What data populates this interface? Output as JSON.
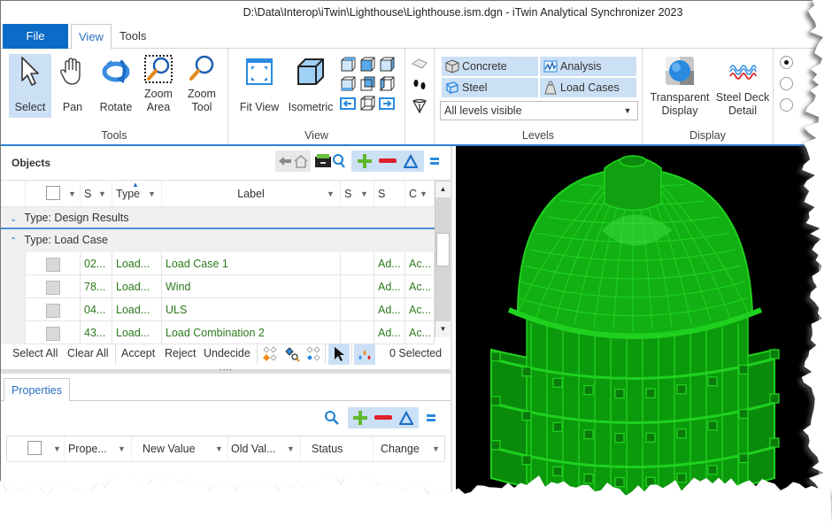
{
  "window": {
    "title": "D:\\Data\\Interop\\iTwin\\Lighthouse\\Lighthouse.ism.dgn - iTwin Analytical Synchronizer 2023"
  },
  "ribbon_tabs": [
    {
      "label": "File",
      "state": "file"
    },
    {
      "label": "View",
      "state": "active"
    },
    {
      "label": "Tools",
      "state": "normal"
    }
  ],
  "ribbon": {
    "tools_group": {
      "label": "Tools",
      "buttons": [
        {
          "label": "Select",
          "icon": "cursor-arrow-icon",
          "selected": true
        },
        {
          "label": "Pan",
          "icon": "hand-icon"
        },
        {
          "label": "Rotate",
          "icon": "rotate-icon"
        },
        {
          "label": "Zoom Area",
          "icon": "zoom-area-icon"
        },
        {
          "label": "Zoom Tool",
          "icon": "zoom-tool-icon"
        }
      ]
    },
    "view_group": {
      "label": "View",
      "buttons": [
        {
          "label": "Fit View",
          "icon": "fit-view-icon"
        },
        {
          "label": "Isometric",
          "icon": "isometric-cube-icon"
        }
      ],
      "view_cubes": [
        "top-view",
        "front-view",
        "right-view",
        "bottom-view",
        "back-view",
        "left-view",
        "rotate-left",
        "iso-view",
        "rotate-right"
      ]
    },
    "nav_group": {
      "buttons": [
        "fly-icon",
        "walk-footprints-icon",
        "clip-volume-icon"
      ]
    },
    "levels_group": {
      "label": "Levels",
      "toggles": [
        {
          "label": "Concrete",
          "icon": "concrete-cube-icon"
        },
        {
          "label": "Analysis",
          "icon": "analysis-chart-icon"
        },
        {
          "label": "Steel",
          "icon": "steel-beam-icon"
        },
        {
          "label": "Load Cases",
          "icon": "weight-icon"
        }
      ],
      "dropdown": {
        "value": "All levels visible"
      }
    },
    "display_group": {
      "label": "Display",
      "buttons": [
        {
          "label": "Transparent Display",
          "line1": "Transparent",
          "line2": "Display",
          "icon": "transparent-sphere-icon"
        },
        {
          "label": "Steel Deck Detail",
          "line1": "Steel Deck",
          "line2": "Detail",
          "icon": "steel-deck-icon"
        }
      ]
    },
    "radio_options": [
      {
        "checked": true
      },
      {
        "checked": false
      },
      {
        "checked": false
      }
    ]
  },
  "objects_panel": {
    "title": "Objects",
    "columns": [
      "",
      "S",
      "Type",
      "Label",
      "S",
      "S",
      "C"
    ],
    "sorted_column": "Type",
    "groups": [
      {
        "label": "Type: Design Results",
        "expanded": false
      },
      {
        "label": "Type: Load Case",
        "expanded": true
      }
    ],
    "rows": [
      {
        "s": "02...",
        "type": "Load...",
        "label": "Load Case 1",
        "s2": "",
        "s3": "Ad...",
        "c": "Ac..."
      },
      {
        "s": "78...",
        "type": "Load...",
        "label": "Wind",
        "s2": "",
        "s3": "Ad...",
        "c": "Ac..."
      },
      {
        "s": "04...",
        "type": "Load...",
        "label": "ULS",
        "s2": "",
        "s3": "Ad...",
        "c": "Ac..."
      },
      {
        "s": "43...",
        "type": "Load...",
        "label": "Load Combination 2",
        "s2": "",
        "s3": "Ad...",
        "c": "Ac..."
      }
    ],
    "actions": {
      "select_all": "Select All",
      "clear_all": "Clear All",
      "accept": "Accept",
      "reject": "Reject",
      "undecide": "Undecide",
      "selected_count": "0 Selected"
    }
  },
  "properties_panel": {
    "tab": "Properties",
    "columns": [
      "",
      "Prope...",
      "New Value",
      "Old Val...",
      "Status",
      "Change"
    ]
  },
  "colors": {
    "accent": "#0b6bc6",
    "selection": "#cce0f5",
    "row_text": "#2c7a1c",
    "model_green": "#1fd11f",
    "viewport_bg": "#000000"
  }
}
